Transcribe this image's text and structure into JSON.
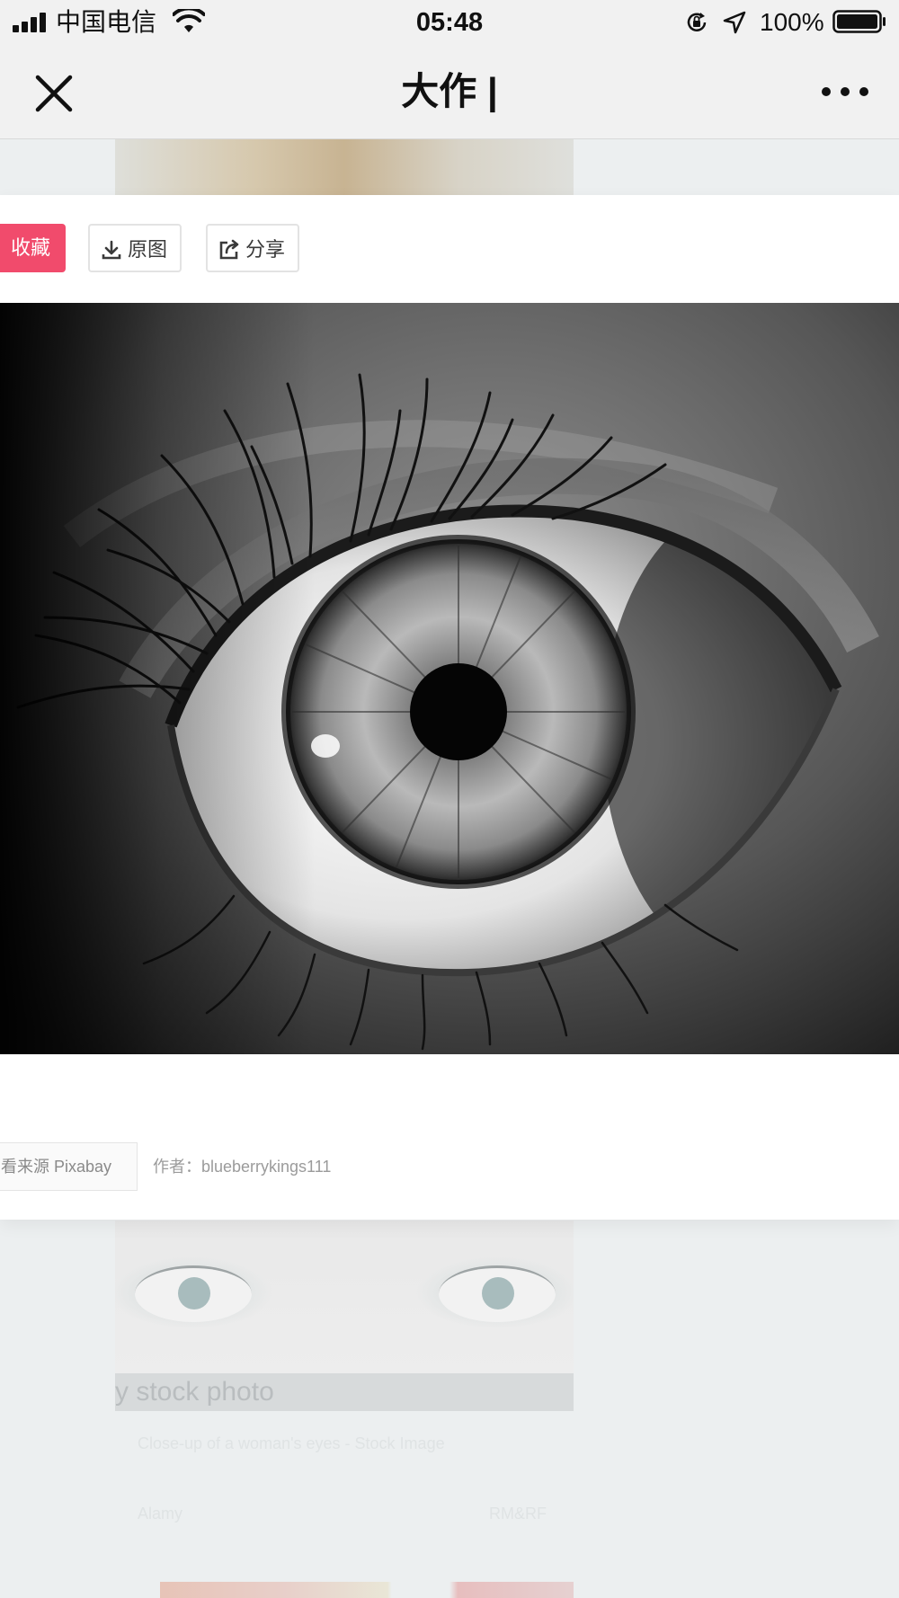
{
  "status_bar": {
    "carrier": "中国电信",
    "time": "05:48",
    "battery_percent": "100%",
    "battery_level": 1.0
  },
  "nav": {
    "title": "大作 |"
  },
  "background_list": {
    "card2_overlay_text": "y stock photo",
    "card2_caption": "Close-up of a woman's eyes - Stock Image",
    "card2_source": "Alamy",
    "card2_license": "RM&RF"
  },
  "panel": {
    "actions": {
      "favorite_label": "收藏",
      "original_label": "原图",
      "share_label": "分享"
    },
    "source_tag": "看来源 Pixabay",
    "author": "作者：blueberrykings111"
  },
  "icons": {
    "close": "close-icon",
    "more": "more-icon",
    "download": "download-icon",
    "share": "share-icon",
    "wifi": "wifi-icon",
    "location": "location-arrow-icon",
    "rotation_lock": "rotation-lock-icon"
  },
  "colors": {
    "favorite_accent": "#f14b6c",
    "bar_background": "#f1f1f1",
    "page_background": "#eceff0"
  }
}
